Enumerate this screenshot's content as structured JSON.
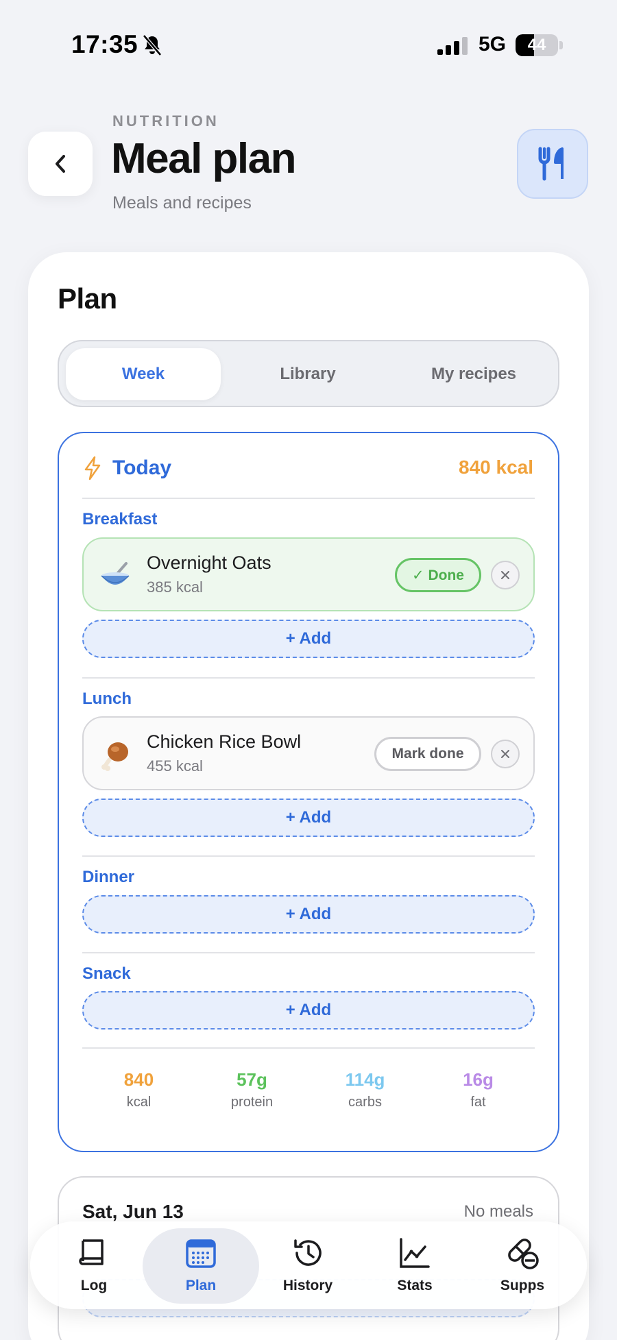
{
  "status_bar": {
    "time": "17:35",
    "network": "5G",
    "battery": "44",
    "battery_level": 0.44
  },
  "header": {
    "eyebrow": "NUTRITION",
    "title": "Meal plan",
    "subtitle": "Meals and recipes"
  },
  "plan": {
    "title": "Plan",
    "tabs": [
      {
        "label": "Week",
        "active": true
      },
      {
        "label": "Library",
        "active": false
      },
      {
        "label": "My recipes",
        "active": false
      }
    ]
  },
  "today": {
    "label": "Today",
    "total_kcal": "840 kcal",
    "meals": [
      {
        "label": "Breakfast",
        "items": [
          {
            "name": "Overnight Oats",
            "kcal": "385 kcal",
            "status": "✓ Done"
          }
        ],
        "add_label": "+ Add"
      },
      {
        "label": "Lunch",
        "items": [
          {
            "name": "Chicken Rice Bowl",
            "kcal": "455 kcal",
            "status": "Mark done"
          }
        ],
        "add_label": "+ Add"
      },
      {
        "label": "Dinner",
        "items": [],
        "add_label": "+ Add"
      },
      {
        "label": "Snack",
        "items": [],
        "add_label": "+ Add"
      }
    ],
    "totals": [
      {
        "value": "840",
        "label": "kcal",
        "color": "#f0a23c"
      },
      {
        "value": "57g",
        "label": "protein",
        "color": "#5cc25c"
      },
      {
        "value": "114g",
        "label": "carbs",
        "color": "#7cc8ef"
      },
      {
        "value": "16g",
        "label": "fat",
        "color": "#b98ae6"
      }
    ]
  },
  "next_day": {
    "title": "Sat, Jun 13",
    "status": "No meals"
  },
  "bottom_nav": [
    {
      "label": "Log",
      "icon": "book-icon",
      "active": false
    },
    {
      "label": "Plan",
      "icon": "calendar-icon",
      "active": true
    },
    {
      "label": "History",
      "icon": "history-icon",
      "active": false
    },
    {
      "label": "Stats",
      "icon": "chart-icon",
      "active": false
    },
    {
      "label": "Supps",
      "icon": "pills-icon",
      "active": false
    }
  ],
  "colors": {
    "accent": "#2f6ad9",
    "done_green": "#66c466",
    "kcal_orange": "#f0a23c"
  }
}
